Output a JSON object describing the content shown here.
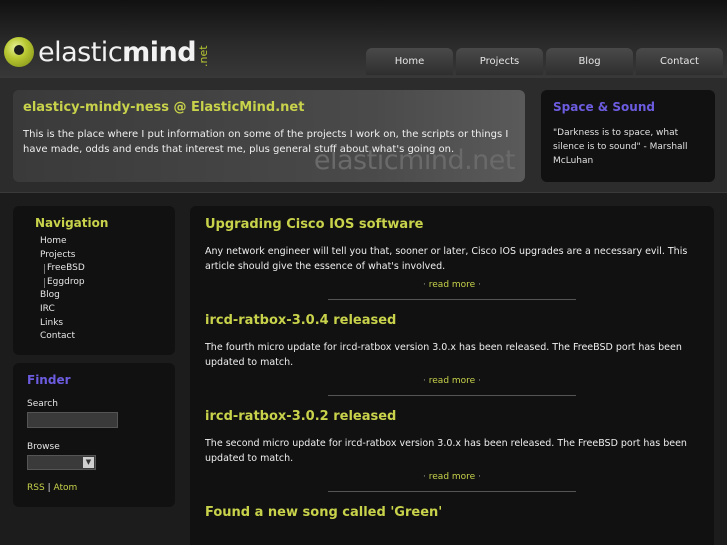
{
  "header": {
    "logo": {
      "name_light": "elastic",
      "name_bold": "mind",
      "tld": ".net"
    },
    "tabs": [
      "Home",
      "Projects",
      "Blog",
      "Contact"
    ]
  },
  "intro": {
    "title": "elasticy-mindy-ness @ ElasticMind.net",
    "text": "This is the place where I put information on some of the projects I work on, the scripts or things I have made, odds and ends that interest me, plus general stuff about what's going on.",
    "watermark": "elasticmind.net"
  },
  "space": {
    "title": "Space & Sound",
    "quote": "\"Darkness is to space, what silence is to sound\" - Marshall McLuhan"
  },
  "navigation": {
    "title": "Navigation",
    "items": [
      {
        "label": "Home",
        "sub": false
      },
      {
        "label": "Projects",
        "sub": false
      },
      {
        "label": "FreeBSD",
        "sub": true
      },
      {
        "label": "Eggdrop",
        "sub": true
      },
      {
        "label": "Blog",
        "sub": false
      },
      {
        "label": "IRC",
        "sub": false
      },
      {
        "label": "Links",
        "sub": false
      },
      {
        "label": "Contact",
        "sub": false
      }
    ]
  },
  "finder": {
    "title": "Finder",
    "search_label": "Search",
    "browse_label": "Browse",
    "rss": "RSS",
    "separator": "|",
    "atom": "Atom"
  },
  "posts": [
    {
      "title": "Upgrading Cisco IOS software",
      "body": "Any network engineer will tell you that, sooner or later, Cisco IOS upgrades are a necessary evil. This article should give the essence of what's involved.",
      "read_more": "read more"
    },
    {
      "title": "ircd-ratbox-3.0.4 released",
      "body": "The fourth micro update for ircd-ratbox version 3.0.x has been released. The FreeBSD port has been updated to match.",
      "read_more": "read more"
    },
    {
      "title": "ircd-ratbox-3.0.2 released",
      "body": "The second micro update for ircd-ratbox version 3.0.x has been released. The FreeBSD port has been updated to match.",
      "read_more": "read more"
    },
    {
      "title": "Found a new song called 'Green'",
      "body": "",
      "read_more": ""
    }
  ],
  "colors": {
    "accent_green": "#c8d24a",
    "accent_purple": "#6c5ce0",
    "background": "#1c1c1c"
  }
}
